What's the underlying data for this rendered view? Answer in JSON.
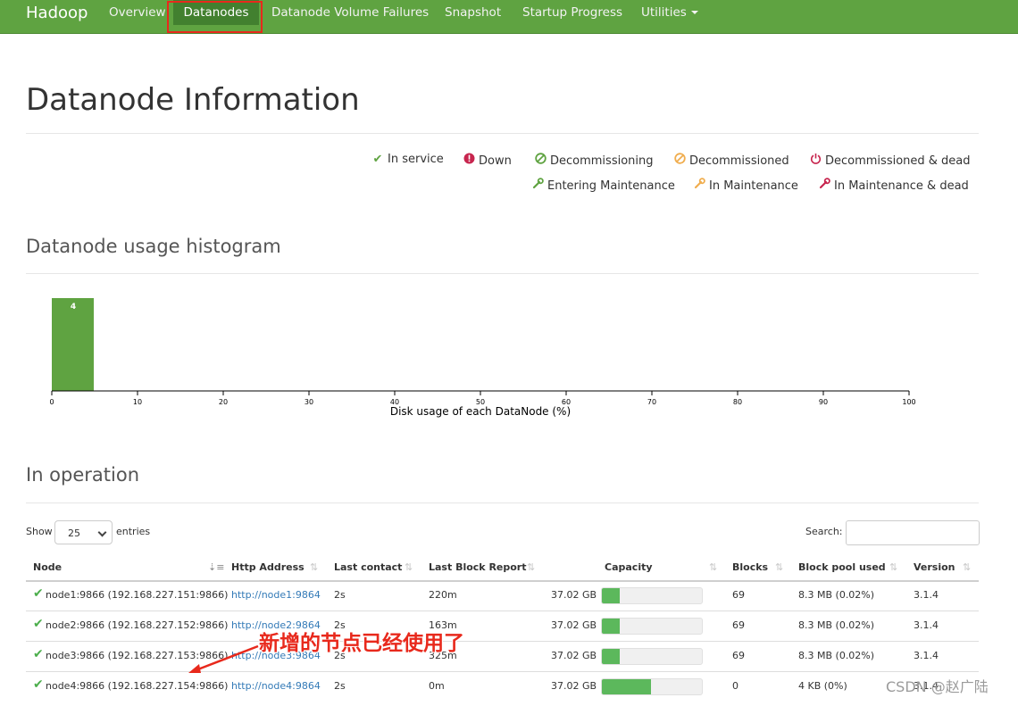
{
  "navbar": {
    "brand": "Hadoop",
    "items": [
      {
        "label": "Overview"
      },
      {
        "label": "Datanodes"
      },
      {
        "label": "Datanode Volume Failures"
      },
      {
        "label": "Snapshot"
      },
      {
        "label": "Startup Progress"
      },
      {
        "label": "Utilities"
      }
    ],
    "active": "Datanodes",
    "color": "#5fa341"
  },
  "page_title": "Datanode Information",
  "legend": [
    {
      "icon": "check-icon",
      "label": "In service",
      "color": "#5fa341"
    },
    {
      "icon": "exclamation-circle-icon",
      "label": "Down",
      "color": "#c7254e"
    },
    {
      "icon": "ban-icon",
      "label": "Decommissioning",
      "color": "#5fa341"
    },
    {
      "icon": "ban-icon",
      "label": "Decommissioned",
      "color": "#f0ad4e"
    },
    {
      "icon": "power-icon",
      "label": "Decommissioned & dead",
      "color": "#c7254e"
    },
    {
      "icon": "wrench-icon",
      "label": "Entering Maintenance",
      "color": "#5fa341"
    },
    {
      "icon": "wrench-icon",
      "label": "In Maintenance",
      "color": "#f0ad4e"
    },
    {
      "icon": "wrench-icon",
      "label": "In Maintenance & dead",
      "color": "#c7254e"
    }
  ],
  "histogram_title": "Datanode usage histogram",
  "chart_data": {
    "type": "bar",
    "bins": [
      {
        "x0": 0,
        "x1": 5,
        "count": 4
      }
    ],
    "xlabel": "Disk usage of each DataNode (%)",
    "xlim": [
      0,
      100
    ],
    "xticks": [
      0,
      10,
      20,
      30,
      40,
      50,
      60,
      70,
      80,
      90,
      100
    ],
    "bar_color": "#5fa341"
  },
  "operation": {
    "title": "In operation",
    "show_label": "Show",
    "entries_value": "25",
    "entries_label": "entries",
    "search_label": "Search:",
    "search_value": "",
    "columns": [
      "Node",
      "Http Address",
      "Last contact",
      "Last Block Report",
      "Capacity",
      "Blocks",
      "Block pool used",
      "Version"
    ],
    "rows": [
      {
        "node": "node1:9866 (192.168.227.151:9866)",
        "http": "http://node1:9864",
        "last_contact": "2s",
        "last_block_report": "220m",
        "capacity": "37.02 GB",
        "usage_pct": 18,
        "blocks": "69",
        "block_pool_used": "8.3 MB (0.02%)",
        "version": "3.1.4"
      },
      {
        "node": "node2:9866 (192.168.227.152:9866)",
        "http": "http://node2:9864",
        "last_contact": "2s",
        "last_block_report": "163m",
        "capacity": "37.02 GB",
        "usage_pct": 18,
        "blocks": "69",
        "block_pool_used": "8.3 MB (0.02%)",
        "version": "3.1.4"
      },
      {
        "node": "node3:9866 (192.168.227.153:9866)",
        "http": "http://node3:9864",
        "last_contact": "2s",
        "last_block_report": "325m",
        "capacity": "37.02 GB",
        "usage_pct": 18,
        "blocks": "69",
        "block_pool_used": "8.3 MB (0.02%)",
        "version": "3.1.4"
      },
      {
        "node": "node4:9866 (192.168.227.154:9866)",
        "http": "http://node4:9864",
        "last_contact": "2s",
        "last_block_report": "0m",
        "capacity": "37.02 GB",
        "usage_pct": 49,
        "blocks": "0",
        "block_pool_used": "4 KB (0%)",
        "version": "3.1.4"
      }
    ]
  },
  "annotation": "新增的节点已经使用了",
  "watermark": "CSDN @赵广陆"
}
